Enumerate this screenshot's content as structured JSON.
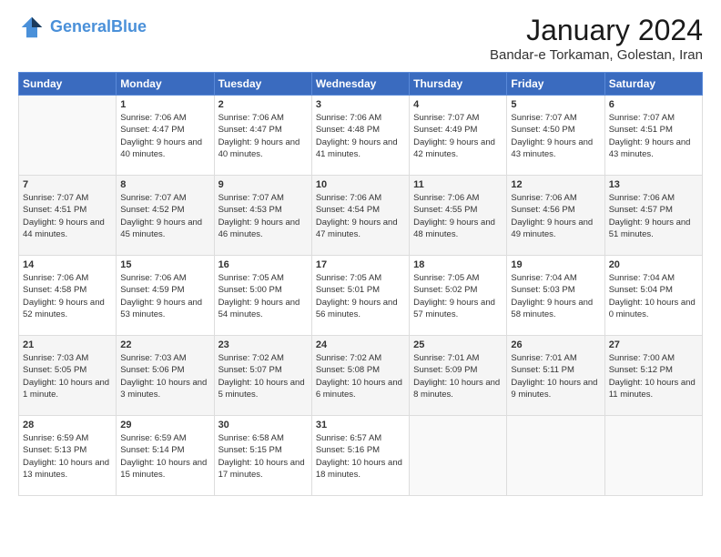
{
  "header": {
    "logo_line1": "General",
    "logo_line2": "Blue",
    "month_year": "January 2024",
    "location": "Bandar-e Torkaman, Golestan, Iran"
  },
  "days_of_week": [
    "Sunday",
    "Monday",
    "Tuesday",
    "Wednesday",
    "Thursday",
    "Friday",
    "Saturday"
  ],
  "weeks": [
    [
      {
        "day": "",
        "empty": true
      },
      {
        "day": "1",
        "sunrise": "Sunrise: 7:06 AM",
        "sunset": "Sunset: 4:47 PM",
        "daylight": "Daylight: 9 hours and 40 minutes."
      },
      {
        "day": "2",
        "sunrise": "Sunrise: 7:06 AM",
        "sunset": "Sunset: 4:47 PM",
        "daylight": "Daylight: 9 hours and 40 minutes."
      },
      {
        "day": "3",
        "sunrise": "Sunrise: 7:06 AM",
        "sunset": "Sunset: 4:48 PM",
        "daylight": "Daylight: 9 hours and 41 minutes."
      },
      {
        "day": "4",
        "sunrise": "Sunrise: 7:07 AM",
        "sunset": "Sunset: 4:49 PM",
        "daylight": "Daylight: 9 hours and 42 minutes."
      },
      {
        "day": "5",
        "sunrise": "Sunrise: 7:07 AM",
        "sunset": "Sunset: 4:50 PM",
        "daylight": "Daylight: 9 hours and 43 minutes."
      },
      {
        "day": "6",
        "sunrise": "Sunrise: 7:07 AM",
        "sunset": "Sunset: 4:51 PM",
        "daylight": "Daylight: 9 hours and 43 minutes."
      }
    ],
    [
      {
        "day": "7",
        "sunrise": "Sunrise: 7:07 AM",
        "sunset": "Sunset: 4:51 PM",
        "daylight": "Daylight: 9 hours and 44 minutes."
      },
      {
        "day": "8",
        "sunrise": "Sunrise: 7:07 AM",
        "sunset": "Sunset: 4:52 PM",
        "daylight": "Daylight: 9 hours and 45 minutes."
      },
      {
        "day": "9",
        "sunrise": "Sunrise: 7:07 AM",
        "sunset": "Sunset: 4:53 PM",
        "daylight": "Daylight: 9 hours and 46 minutes."
      },
      {
        "day": "10",
        "sunrise": "Sunrise: 7:06 AM",
        "sunset": "Sunset: 4:54 PM",
        "daylight": "Daylight: 9 hours and 47 minutes."
      },
      {
        "day": "11",
        "sunrise": "Sunrise: 7:06 AM",
        "sunset": "Sunset: 4:55 PM",
        "daylight": "Daylight: 9 hours and 48 minutes."
      },
      {
        "day": "12",
        "sunrise": "Sunrise: 7:06 AM",
        "sunset": "Sunset: 4:56 PM",
        "daylight": "Daylight: 9 hours and 49 minutes."
      },
      {
        "day": "13",
        "sunrise": "Sunrise: 7:06 AM",
        "sunset": "Sunset: 4:57 PM",
        "daylight": "Daylight: 9 hours and 51 minutes."
      }
    ],
    [
      {
        "day": "14",
        "sunrise": "Sunrise: 7:06 AM",
        "sunset": "Sunset: 4:58 PM",
        "daylight": "Daylight: 9 hours and 52 minutes."
      },
      {
        "day": "15",
        "sunrise": "Sunrise: 7:06 AM",
        "sunset": "Sunset: 4:59 PM",
        "daylight": "Daylight: 9 hours and 53 minutes."
      },
      {
        "day": "16",
        "sunrise": "Sunrise: 7:05 AM",
        "sunset": "Sunset: 5:00 PM",
        "daylight": "Daylight: 9 hours and 54 minutes."
      },
      {
        "day": "17",
        "sunrise": "Sunrise: 7:05 AM",
        "sunset": "Sunset: 5:01 PM",
        "daylight": "Daylight: 9 hours and 56 minutes."
      },
      {
        "day": "18",
        "sunrise": "Sunrise: 7:05 AM",
        "sunset": "Sunset: 5:02 PM",
        "daylight": "Daylight: 9 hours and 57 minutes."
      },
      {
        "day": "19",
        "sunrise": "Sunrise: 7:04 AM",
        "sunset": "Sunset: 5:03 PM",
        "daylight": "Daylight: 9 hours and 58 minutes."
      },
      {
        "day": "20",
        "sunrise": "Sunrise: 7:04 AM",
        "sunset": "Sunset: 5:04 PM",
        "daylight": "Daylight: 10 hours and 0 minutes."
      }
    ],
    [
      {
        "day": "21",
        "sunrise": "Sunrise: 7:03 AM",
        "sunset": "Sunset: 5:05 PM",
        "daylight": "Daylight: 10 hours and 1 minute."
      },
      {
        "day": "22",
        "sunrise": "Sunrise: 7:03 AM",
        "sunset": "Sunset: 5:06 PM",
        "daylight": "Daylight: 10 hours and 3 minutes."
      },
      {
        "day": "23",
        "sunrise": "Sunrise: 7:02 AM",
        "sunset": "Sunset: 5:07 PM",
        "daylight": "Daylight: 10 hours and 5 minutes."
      },
      {
        "day": "24",
        "sunrise": "Sunrise: 7:02 AM",
        "sunset": "Sunset: 5:08 PM",
        "daylight": "Daylight: 10 hours and 6 minutes."
      },
      {
        "day": "25",
        "sunrise": "Sunrise: 7:01 AM",
        "sunset": "Sunset: 5:09 PM",
        "daylight": "Daylight: 10 hours and 8 minutes."
      },
      {
        "day": "26",
        "sunrise": "Sunrise: 7:01 AM",
        "sunset": "Sunset: 5:11 PM",
        "daylight": "Daylight: 10 hours and 9 minutes."
      },
      {
        "day": "27",
        "sunrise": "Sunrise: 7:00 AM",
        "sunset": "Sunset: 5:12 PM",
        "daylight": "Daylight: 10 hours and 11 minutes."
      }
    ],
    [
      {
        "day": "28",
        "sunrise": "Sunrise: 6:59 AM",
        "sunset": "Sunset: 5:13 PM",
        "daylight": "Daylight: 10 hours and 13 minutes."
      },
      {
        "day": "29",
        "sunrise": "Sunrise: 6:59 AM",
        "sunset": "Sunset: 5:14 PM",
        "daylight": "Daylight: 10 hours and 15 minutes."
      },
      {
        "day": "30",
        "sunrise": "Sunrise: 6:58 AM",
        "sunset": "Sunset: 5:15 PM",
        "daylight": "Daylight: 10 hours and 17 minutes."
      },
      {
        "day": "31",
        "sunrise": "Sunrise: 6:57 AM",
        "sunset": "Sunset: 5:16 PM",
        "daylight": "Daylight: 10 hours and 18 minutes."
      },
      {
        "day": "",
        "empty": true
      },
      {
        "day": "",
        "empty": true
      },
      {
        "day": "",
        "empty": true
      }
    ]
  ]
}
